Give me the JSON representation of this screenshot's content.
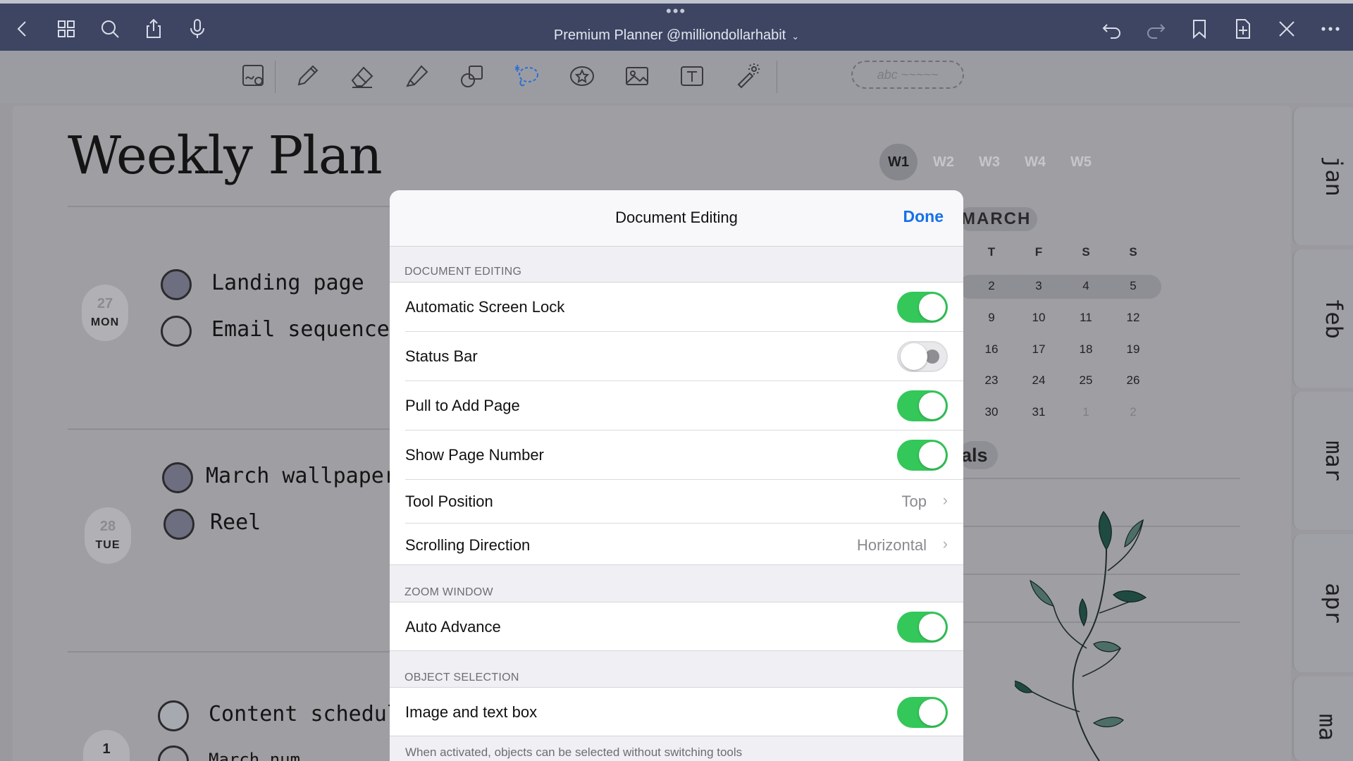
{
  "topbar": {
    "grip": "•••",
    "title": "Premium Planner @milliondollarhabit",
    "title_chevron": "⌄"
  },
  "toolbar": {
    "lasso_placeholder": "abc ~~~~~"
  },
  "page": {
    "heading": "Weekly Plan",
    "week_tabs": [
      "W1",
      "W2",
      "W3",
      "W4",
      "W5"
    ],
    "active_week": "W1",
    "days": [
      {
        "num": "27",
        "weekday": "MON"
      },
      {
        "num": "28",
        "weekday": "TUE"
      },
      {
        "num": "1",
        "weekday": ""
      }
    ],
    "tasks": [
      {
        "text": "Landing page",
        "state": "filled"
      },
      {
        "text": "Email sequence",
        "state": "empty"
      },
      {
        "text": "March wallpaper",
        "state": "filled"
      },
      {
        "text": "Reel",
        "state": "filled"
      },
      {
        "text": "Content schedul",
        "state": "light"
      },
      {
        "text": "March num",
        "state": "empty"
      }
    ],
    "calendar": {
      "month": "MARCH",
      "headers": [
        "T",
        "F",
        "S",
        "S"
      ],
      "rows": [
        [
          "2",
          "3",
          "4",
          "5"
        ],
        [
          "9",
          "10",
          "11",
          "12"
        ],
        [
          "16",
          "17",
          "18",
          "19"
        ],
        [
          "23",
          "24",
          "25",
          "26"
        ],
        [
          "30",
          "31",
          "1",
          "2"
        ]
      ]
    },
    "goals_label": "als",
    "month_tabs": [
      "jan",
      "feb",
      "mar",
      "apr",
      "ma"
    ]
  },
  "modal": {
    "title": "Document Editing",
    "done": "Done",
    "sections": [
      {
        "header": "DOCUMENT EDITING"
      },
      {
        "header": "ZOOM WINDOW"
      },
      {
        "header": "OBJECT SELECTION"
      }
    ],
    "rows": {
      "auto_lock": {
        "label": "Automatic Screen Lock",
        "on": true
      },
      "status_bar": {
        "label": "Status Bar",
        "on": false
      },
      "pull_add": {
        "label": "Pull to Add Page",
        "on": true
      },
      "page_number": {
        "label": "Show Page Number",
        "on": true
      },
      "tool_position": {
        "label": "Tool Position",
        "value": "Top"
      },
      "scroll_dir": {
        "label": "Scrolling Direction",
        "value": "Horizontal"
      },
      "auto_advance": {
        "label": "Auto Advance",
        "on": true
      },
      "image_text": {
        "label": "Image and text box",
        "on": true
      }
    },
    "footnote": "When activated, objects can be selected without switching tools"
  },
  "colors": {
    "topbar": "#3d4563",
    "toggle_on": "#34c759",
    "accent_link": "#1572e8"
  }
}
